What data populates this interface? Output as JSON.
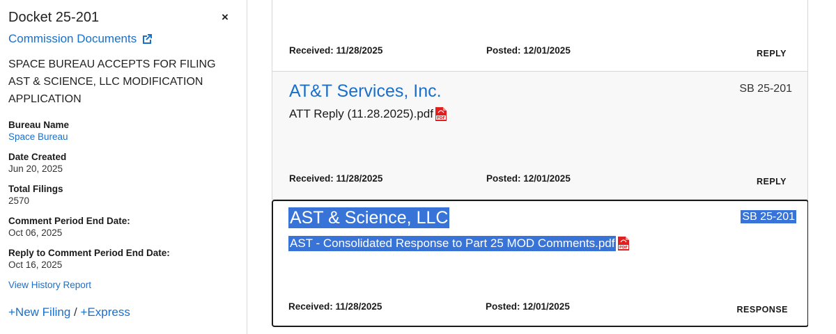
{
  "docket": {
    "title": "Docket 25-201",
    "close_glyph": "×",
    "commission_link": "Commission Documents",
    "description": "SPACE BUREAU ACCEPTS FOR FILING AST & SCIENCE, LLC MODIFICATION APPLICATION",
    "bureau_label": "Bureau Name",
    "bureau_value": "Space Bureau",
    "date_created_label": "Date Created",
    "date_created_value": "Jun 20, 2025",
    "total_filings_label": "Total Filings",
    "total_filings_value": "2570",
    "comment_end_label": "Comment Period End Date:",
    "comment_end_value": "Oct 06, 2025",
    "reply_end_label": "Reply to Comment Period End Date:",
    "reply_end_value": "Oct 16, 2025",
    "history_link": "View History Report",
    "new_filing": "+New Filing",
    "separator": "/",
    "express": "+Express"
  },
  "filings": [
    {
      "received_label": "Received: 11/28/2025",
      "posted_label": "Posted: 12/01/2025",
      "type": "REPLY"
    },
    {
      "filer": "AT&T Services, Inc.",
      "docket": "SB 25-201",
      "file": "ATT Reply (11.28.2025).pdf",
      "received_label": "Received: 11/28/2025",
      "posted_label": "Posted: 12/01/2025",
      "type": "REPLY"
    },
    {
      "filer": "AST & Science, LLC",
      "docket": "SB 25-201",
      "file": "AST - Consolidated Response to Part 25 MOD Comments.pdf",
      "received_label": "Received: 11/28/2025",
      "posted_label": "Posted: 12/01/2025",
      "type": "RESPONSE"
    }
  ],
  "colors": {
    "link": "#1a6fc9",
    "selection": "#3874d8",
    "pdf": "#e02020"
  },
  "icons": {
    "external": "external-link-icon",
    "close": "close-icon",
    "pdf": "pdf-icon"
  }
}
